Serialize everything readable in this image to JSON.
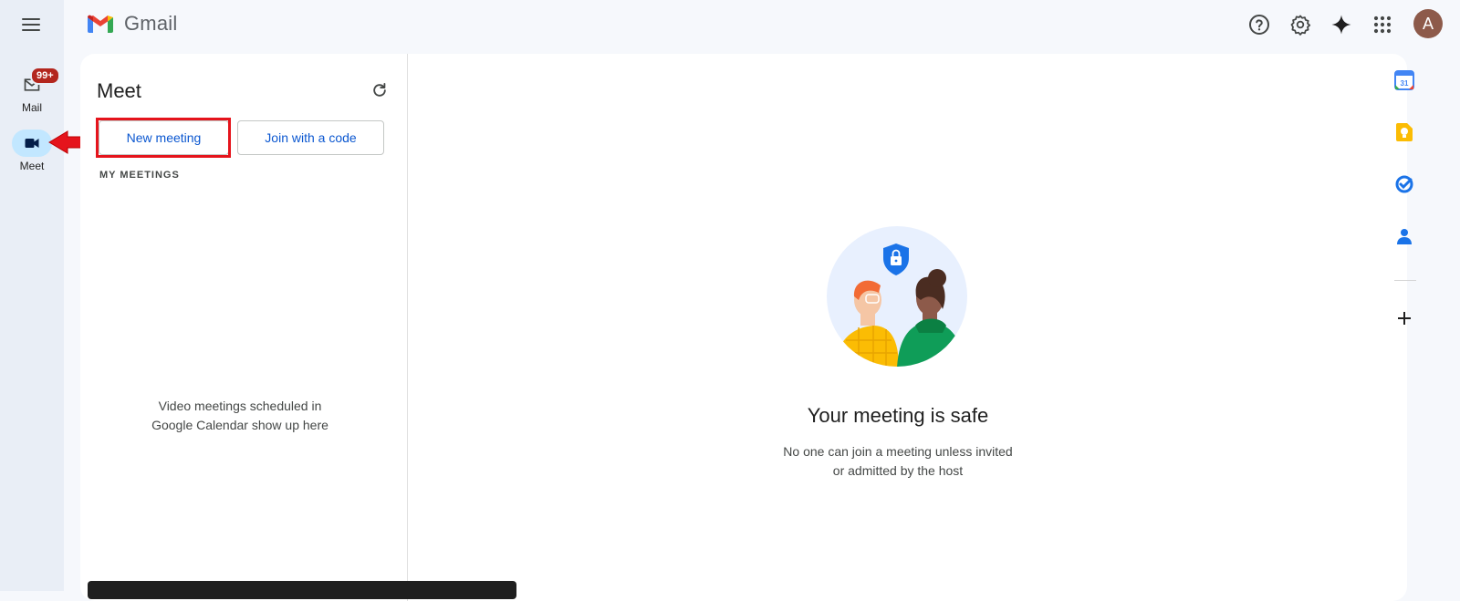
{
  "app": {
    "name": "Gmail"
  },
  "rail": {
    "items": [
      {
        "label": "Mail",
        "badge": "99+"
      },
      {
        "label": "Meet"
      }
    ]
  },
  "meet": {
    "title": "Meet",
    "new_meeting_label": "New meeting",
    "join_label": "Join with a code",
    "section_label": "MY MEETINGS",
    "empty_line1": "Video meetings scheduled in",
    "empty_line2": "Google Calendar show up here"
  },
  "safe": {
    "title": "Your meeting is safe",
    "line1": "No one can join a meeting unless invited",
    "line2": "or admitted by the host"
  },
  "account": {
    "initial": "A",
    "avatar_color": "#8d5a4a"
  },
  "icons": {
    "top": [
      "help-icon",
      "settings-icon",
      "gemini-icon",
      "apps-grid-icon"
    ],
    "side": [
      "calendar-icon",
      "keep-icon",
      "tasks-icon",
      "contacts-icon",
      "add-icon"
    ]
  },
  "colors": {
    "accent": "#0b57d0",
    "highlight": "#e5141c",
    "rail_active": "#c2e7ff",
    "badge": "#b3261e"
  },
  "side_calendar_day": "31"
}
